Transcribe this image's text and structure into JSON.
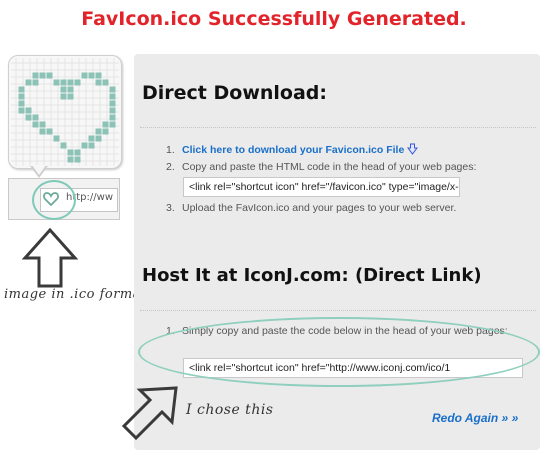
{
  "page": {
    "title": "FavIcon.ico Successfully Generated."
  },
  "preview": {
    "address_text": "http://ww",
    "caption": "image in .ico format",
    "icons": [
      "heart-icon",
      "favicon-icon",
      "up-arrow-icon"
    ]
  },
  "direct": {
    "heading": "Direct Download:",
    "steps": [
      {
        "num": "1.",
        "text": "Click here to download your Favicon.ico File"
      },
      {
        "num": "2.",
        "text": "Copy and paste the HTML code in the head of your web pages:"
      },
      {
        "num": "3.",
        "text": "Upload the FavIcon.ico and your pages to your web server."
      }
    ],
    "code": "<link rel=\"shortcut icon\" href=\"/favicon.ico\" type=\"image/x-icon\">"
  },
  "host": {
    "heading": "Host It at IconJ.com: (Direct Link)",
    "steps": [
      {
        "num": "1.",
        "text": "Simply copy and paste the code below in the head of your web pages:"
      }
    ],
    "code": "<link rel=\"shortcut icon\" href=\"http://www.iconj.com/ico/1",
    "caption": "I chose this"
  },
  "actions": {
    "redo_label": "Redo Again » »"
  },
  "colors": {
    "title_red": "#e2232a",
    "link_blue": "#1a6fc9",
    "annotation_teal": "#8ecfbd",
    "heart_teal": "#7fbfb0"
  }
}
